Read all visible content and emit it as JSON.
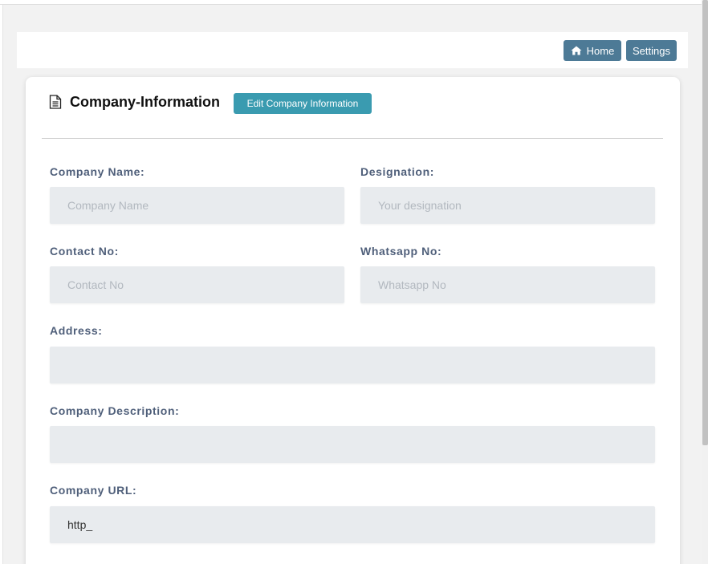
{
  "nav": {
    "home_label": "Home",
    "settings_label": "Settings"
  },
  "card": {
    "title": "Company-Information",
    "edit_button_label": "Edit Company Information"
  },
  "fields": {
    "company_name": {
      "label": "Company Name:",
      "placeholder": "Company Name",
      "value": ""
    },
    "designation": {
      "label": "Designation:",
      "placeholder": "Your designation",
      "value": ""
    },
    "contact_no": {
      "label": "Contact No:",
      "placeholder": "Contact No",
      "value": ""
    },
    "whatsapp_no": {
      "label": "Whatsapp No:",
      "placeholder": "Whatsapp No",
      "value": ""
    },
    "address": {
      "label": "Address:",
      "placeholder": "",
      "value": ""
    },
    "company_description": {
      "label": "Company Description:",
      "placeholder": "",
      "value": ""
    },
    "company_url": {
      "label": "Company URL:",
      "placeholder": "",
      "value": "http_"
    }
  },
  "colors": {
    "nav_button": "#4d7a96",
    "edit_button": "#3a9bb0",
    "label_text": "#4f5f7a",
    "field_bg": "#e8ebee"
  },
  "icons": {
    "home": "home-icon",
    "title": "document-icon"
  }
}
